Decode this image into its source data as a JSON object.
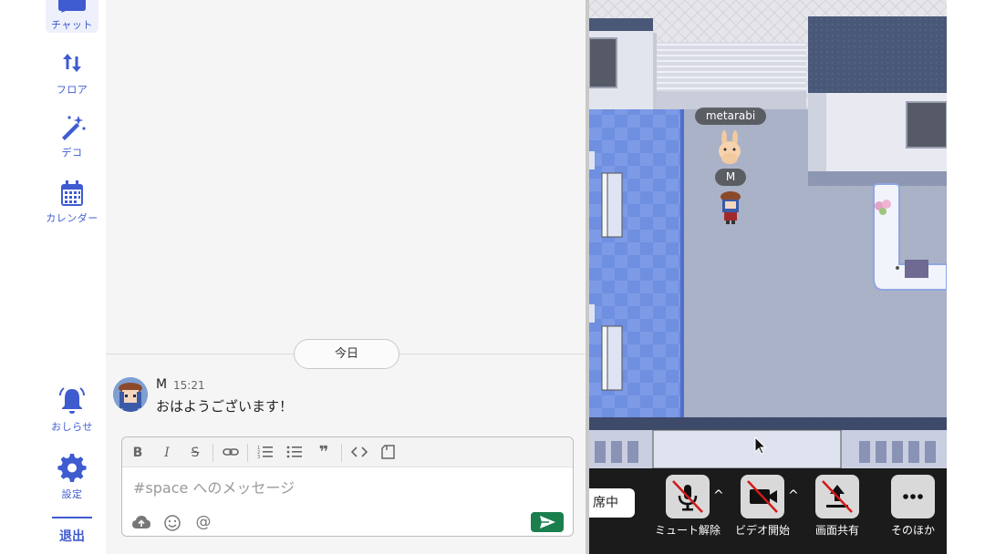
{
  "nav": {
    "chat": "チャット",
    "floor": "フロア",
    "deco": "デコ",
    "calendar": "カレンダー",
    "notify": "おしらせ",
    "settings": "設定",
    "logout": "退出"
  },
  "chat": {
    "date_divider": "今日",
    "message": {
      "author": "M",
      "time": "15:21",
      "text": "おはようございます！"
    },
    "composer": {
      "placeholder": "#space へのメッセージ",
      "toolbar": [
        "bold-icon",
        "italic-icon",
        "strikethrough-icon",
        "link-icon",
        "numbered-list-icon",
        "bullet-list-icon",
        "quote-icon",
        "code-icon",
        "code-block-icon"
      ]
    }
  },
  "game": {
    "avatars": [
      {
        "name": "metarabi"
      },
      {
        "name": "M"
      }
    ],
    "status": "席中",
    "controls": {
      "mic": "ミュート解除",
      "video": "ビデオ開始",
      "share": "画面共有",
      "more": "そのほか"
    }
  },
  "colors": {
    "accent": "#3f5bd0",
    "send": "#1a7f4d",
    "control_bar": "#1b1b1b"
  }
}
